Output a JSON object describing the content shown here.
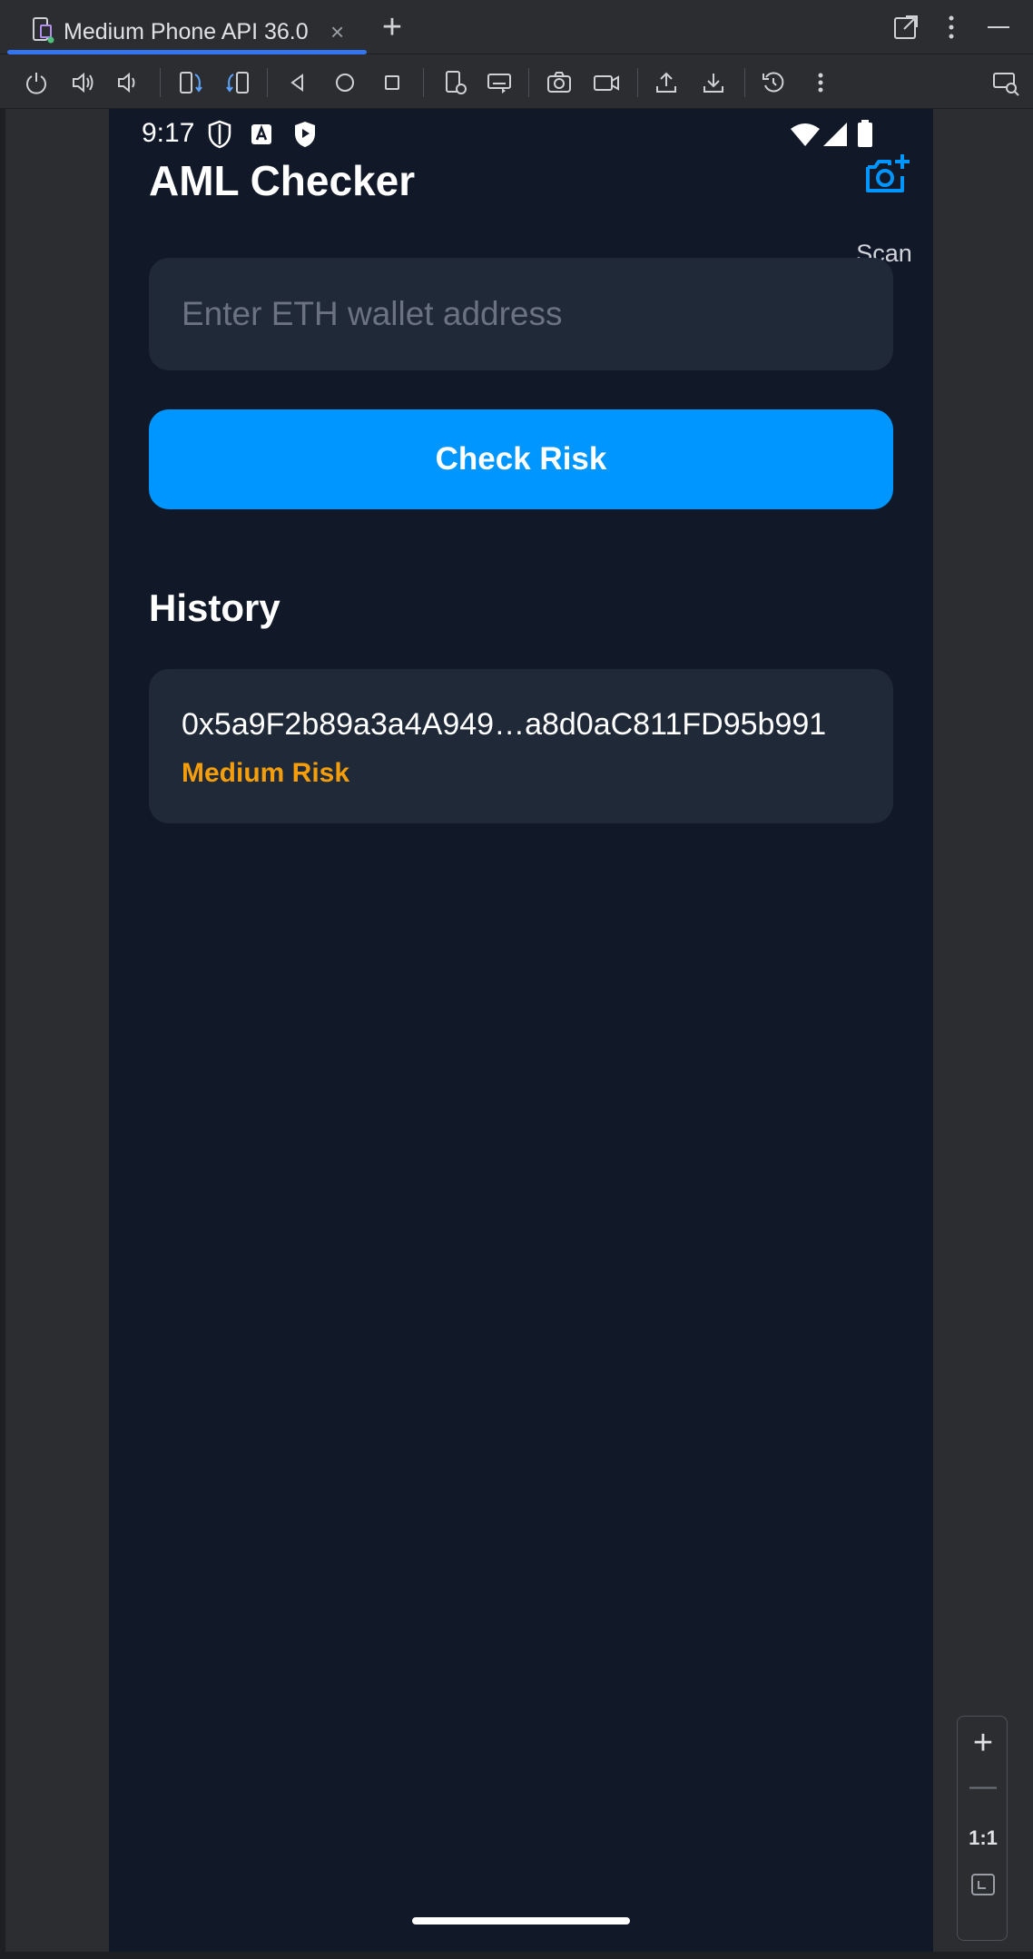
{
  "window": {
    "tab_title": "Medium Phone API 36.0",
    "tab_close": "×",
    "new_tab": "+"
  },
  "toolbar": {
    "buttons": [
      "power-icon",
      "volume-up-icon",
      "volume-down-icon",
      "rotate-left-icon",
      "rotate-right-icon",
      "back-icon",
      "home-icon",
      "overview-icon",
      "device-settings-icon",
      "keyboard-icon",
      "screenshot-icon",
      "screen-record-icon",
      "upload-icon",
      "download-icon",
      "snapshot-icon",
      "more-icon"
    ]
  },
  "status_bar": {
    "time": "9:17"
  },
  "app": {
    "title": "AML Checker",
    "scan_label": "Scan",
    "address_placeholder": "Enter ETH wallet address",
    "address_value": "",
    "check_button_label": "Check Risk",
    "history_heading": "History",
    "history": [
      {
        "address": "0x5a9F2b89a3a4A949…a8d0aC811FD95b991",
        "risk": "Medium Risk",
        "risk_color": "#f59e0b"
      }
    ]
  },
  "colors": {
    "background": "#111827",
    "card": "#1f2937",
    "accent": "#0096ff"
  },
  "zoom_controls": {
    "zoom_in": "+",
    "zoom_out": "—",
    "actual_size": "1:1"
  }
}
